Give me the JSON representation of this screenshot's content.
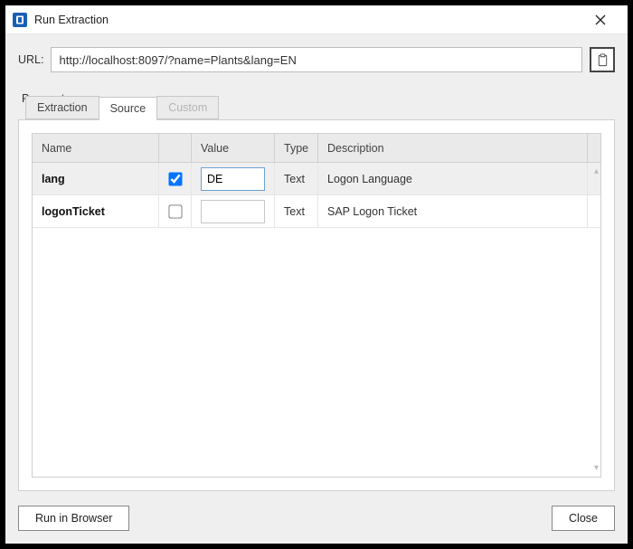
{
  "window": {
    "title": "Run Extraction"
  },
  "url": {
    "label": "URL:",
    "value": "http://localhost:8097/?name=Plants&lang=EN"
  },
  "parameters": {
    "label": "Parameters",
    "tabs": [
      {
        "label": "Extraction",
        "active": false,
        "disabled": false
      },
      {
        "label": "Source",
        "active": true,
        "disabled": false
      },
      {
        "label": "Custom",
        "active": false,
        "disabled": true
      }
    ],
    "columns": {
      "name": "Name",
      "checkbox": "",
      "value": "Value",
      "type": "Type",
      "description": "Description"
    },
    "rows": [
      {
        "name": "lang",
        "checked": true,
        "value": "DE",
        "type": "Text",
        "description": "Logon Language",
        "selected": true
      },
      {
        "name": "logonTicket",
        "checked": false,
        "value": "",
        "type": "Text",
        "description": "SAP Logon Ticket",
        "selected": false
      }
    ]
  },
  "footer": {
    "run_label": "Run in Browser",
    "close_label": "Close"
  }
}
